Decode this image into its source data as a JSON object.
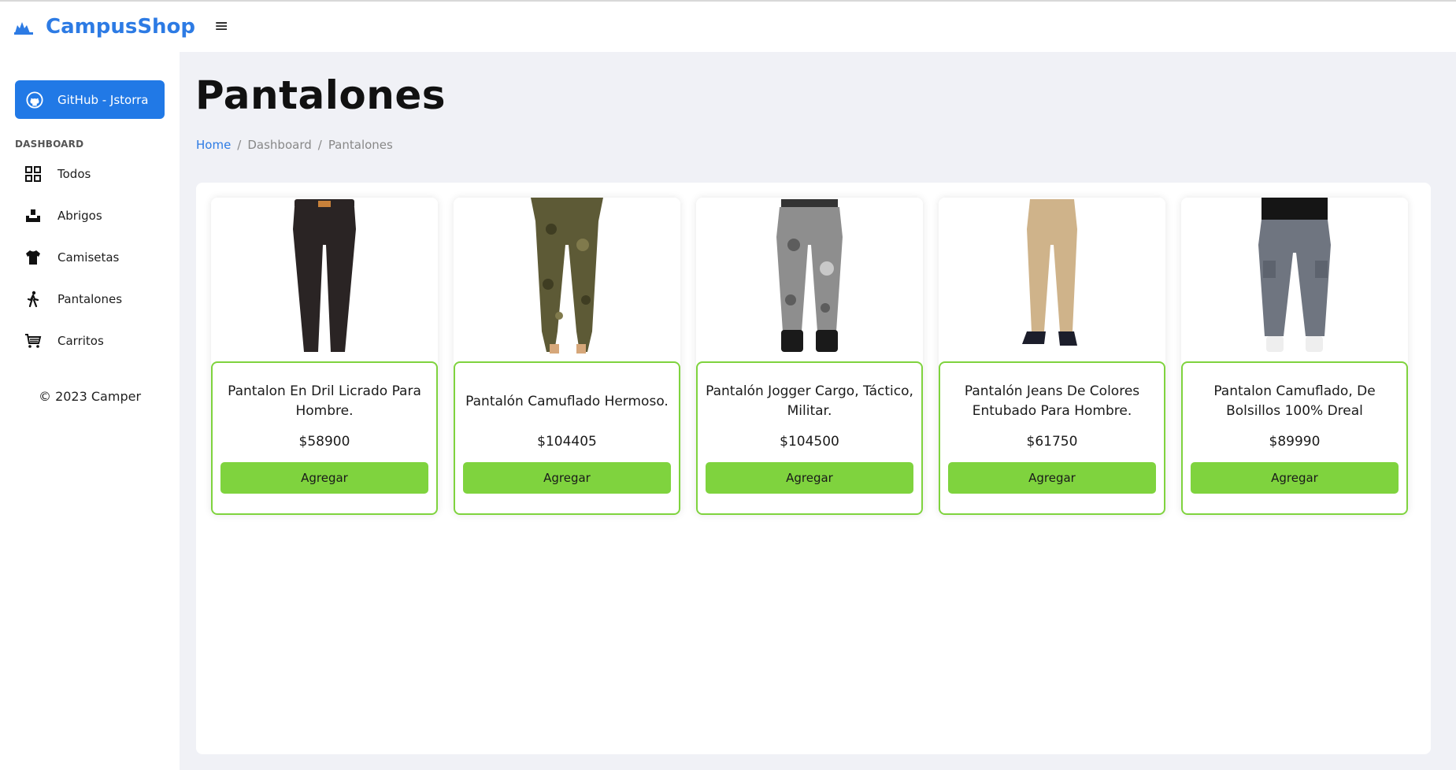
{
  "app": {
    "name": "CampusShop"
  },
  "sidebar": {
    "github_label": "GitHub - Jstorra",
    "section": "DASHBOARD",
    "items": [
      {
        "label": "Todos",
        "icon": "grid-icon"
      },
      {
        "label": "Abrigos",
        "icon": "box-icon"
      },
      {
        "label": "Camisetas",
        "icon": "tshirt-icon"
      },
      {
        "label": "Pantalones",
        "icon": "walking-icon"
      },
      {
        "label": "Carritos",
        "icon": "cart-icon"
      }
    ],
    "copyright": "© 2023 Camper"
  },
  "page": {
    "title": "Pantalones",
    "breadcrumb": [
      "Home",
      "Dashboard",
      "Pantalones"
    ]
  },
  "products": [
    {
      "title": "Pantalon En Dril Licrado Para Hombre.",
      "price": "$58900",
      "button": "Agregar",
      "color": "#2a2424"
    },
    {
      "title": "Pantalón Camuflado Hermoso.",
      "price": "$104405",
      "button": "Agregar",
      "color": "#5d5a36"
    },
    {
      "title": "Pantalón Jogger Cargo, Táctico, Militar.",
      "price": "$104500",
      "button": "Agregar",
      "color": "#8e8e8e"
    },
    {
      "title": "Pantalón Jeans De Colores Entubado Para Hombre.",
      "price": "$61750",
      "button": "Agregar",
      "color": "#cfb38a"
    },
    {
      "title": "Pantalon Camuflado, De Bolsillos 100% Dreal",
      "price": "$89990",
      "button": "Agregar",
      "color": "#6f7580"
    }
  ],
  "colors": {
    "brand": "#2d7be4",
    "accent": "#7fd33e",
    "github": "#2179e6"
  }
}
